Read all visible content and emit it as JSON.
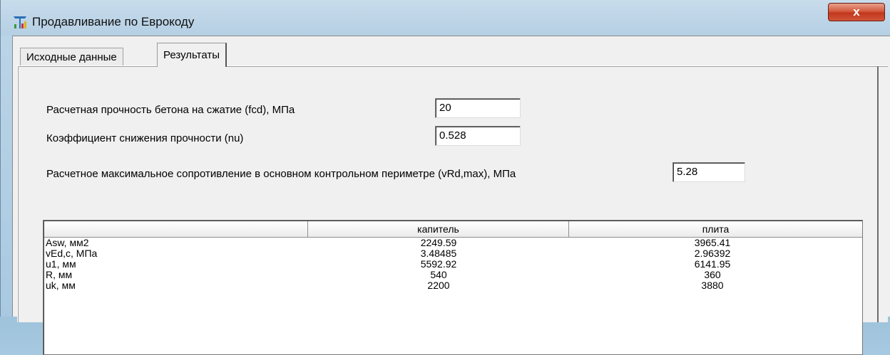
{
  "window": {
    "title": "Продавливание по Еврокоду",
    "close_label": "x"
  },
  "tabs": [
    {
      "label": "Исходные данные"
    },
    {
      "label": "Результаты"
    }
  ],
  "params": [
    {
      "label": "Расчетная прочность бетона на сжатие (fcd), МПа",
      "value": "20"
    },
    {
      "label": "Коэффициент снижения прочности (nu)",
      "value": "0.528"
    },
    {
      "label": "Расчетное максимальное сопротивление в основном контрольном периметре (vRd,max), МПа",
      "value": "5.28"
    }
  ],
  "table": {
    "headers": [
      "",
      "капитель",
      "плита"
    ],
    "rows": [
      [
        "Asw, мм2",
        "2249.59",
        "3965.41"
      ],
      [
        "vEd,c, МПа",
        "3.48485",
        "2.96392"
      ],
      [
        "u1, мм",
        "5592.92",
        "6141.95"
      ],
      [
        "R, мм",
        "540",
        "360"
      ],
      [
        "uk, мм",
        "2200",
        "3880"
      ]
    ]
  },
  "colors": {
    "close_button": "#c8452a",
    "panel_bg": "#f0f0f0",
    "title_bg": "#b9d3e8"
  }
}
